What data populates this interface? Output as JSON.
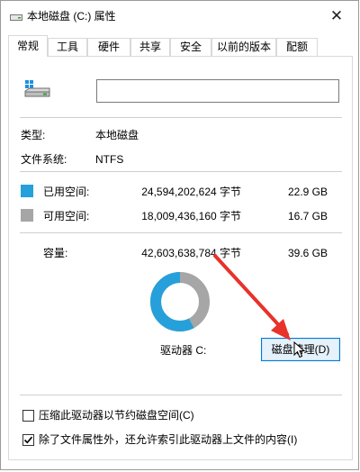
{
  "window": {
    "title": "本地磁盘 (C:) 属性",
    "close_glyph": "✕"
  },
  "tabs": [
    {
      "label": "常规",
      "active": true
    },
    {
      "label": "工具"
    },
    {
      "label": "硬件"
    },
    {
      "label": "共享"
    },
    {
      "label": "安全"
    },
    {
      "label": "以前的版本"
    },
    {
      "label": "配额"
    }
  ],
  "general": {
    "volume_name_value": "",
    "type_label": "类型:",
    "type_value": "本地磁盘",
    "fs_label": "文件系统:",
    "fs_value": "NTFS"
  },
  "space": {
    "used": {
      "label": "已用空间:",
      "bytes": "24,594,202,624 字节",
      "size": "22.9 GB",
      "color": "#26a0da"
    },
    "free": {
      "label": "可用空间:",
      "bytes": "18,009,436,160 字节",
      "size": "16.7 GB",
      "color": "#a6a6a6"
    },
    "capacity": {
      "label": "容量:",
      "bytes": "42,603,638,784 字节",
      "size": "39.6 GB"
    }
  },
  "drive": {
    "label": "驱动器 C:",
    "used_fraction": 0.577
  },
  "buttons": {
    "cleanup_label": "磁盘清理(D)"
  },
  "options": {
    "compress_label": "压缩此驱动器以节约磁盘空间(C)",
    "compress_checked": false,
    "index_label": "除了文件属性外，还允许索引此驱动器上文件的内容(I)",
    "index_checked": true
  },
  "colors": {
    "accent": "#0078d7",
    "annotation_arrow": "#e8322a"
  }
}
